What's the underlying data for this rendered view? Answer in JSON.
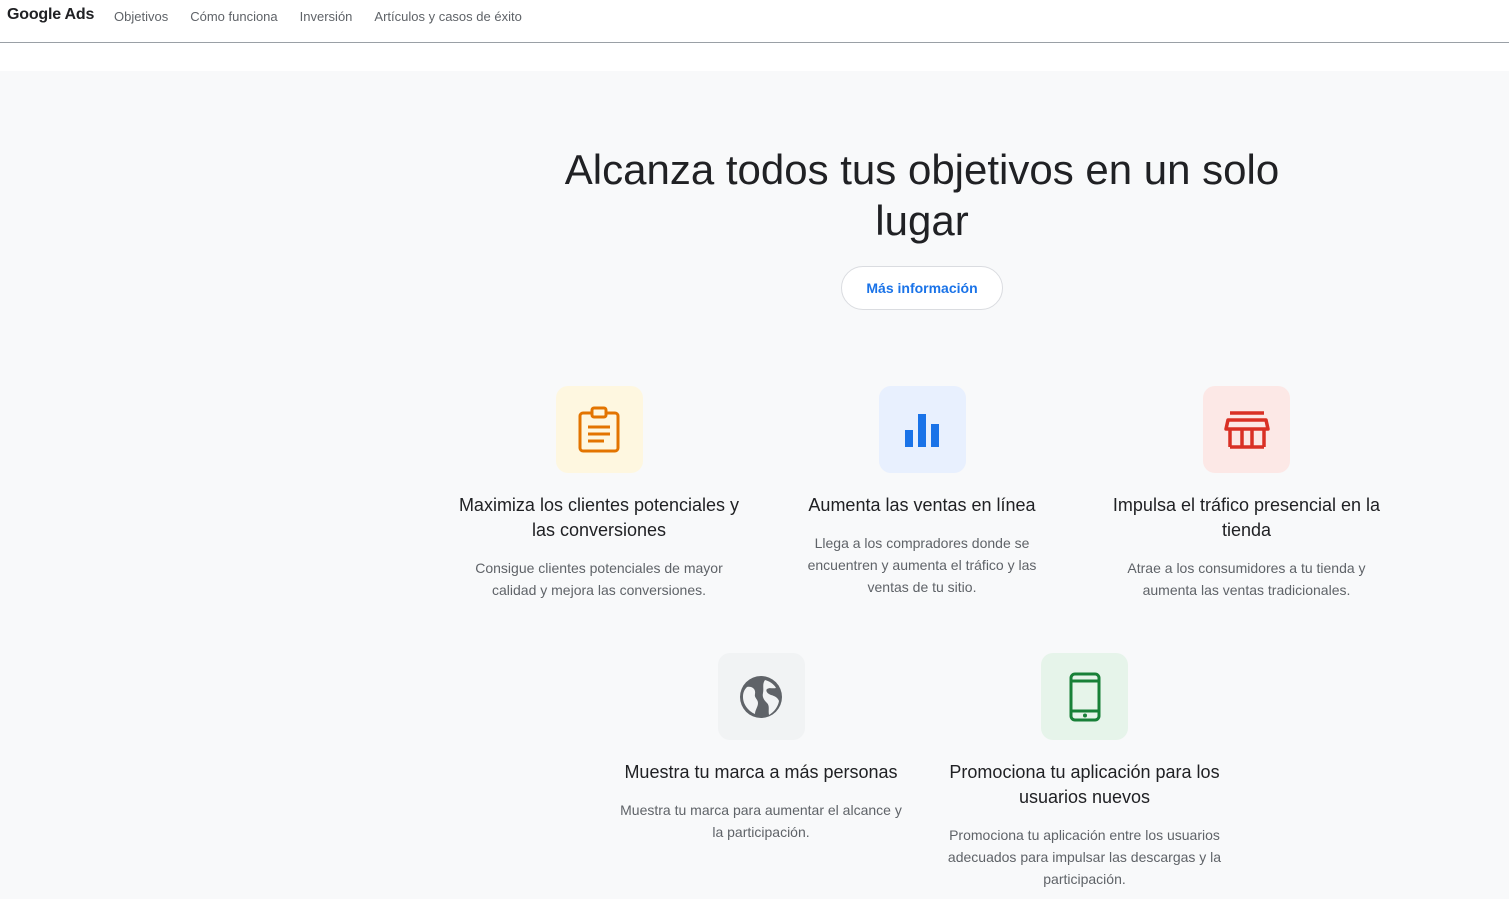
{
  "header": {
    "brand": "Google Ads",
    "nav": [
      {
        "label": "Objetivos"
      },
      {
        "label": "Cómo funciona"
      },
      {
        "label": "Inversión"
      },
      {
        "label": "Artículos y casos de éxito"
      }
    ]
  },
  "hero": {
    "title": "Alcanza todos tus objetivos en un solo lugar",
    "cta_label": "Más información"
  },
  "goals": [
    {
      "icon": "clipboard-icon",
      "title": "Maximiza los clientes potenciales y las conversiones",
      "description": "Consigue clientes potenciales de mayor calidad y mejora las conversiones."
    },
    {
      "icon": "bar-chart-icon",
      "title": "Aumenta las ventas en línea",
      "description": "Llega a los compradores donde se encuentren y aumenta el tráfico y las ventas de tu sitio."
    },
    {
      "icon": "storefront-icon",
      "title": "Impulsa el tráfico presencial en la tienda",
      "description": "Atrae a los consumidores a tu tienda y aumenta las ventas tradicionales."
    },
    {
      "icon": "globe-icon",
      "title": "Muestra tu marca a más personas",
      "description": "Muestra tu marca para aumentar el alcance y la participación."
    },
    {
      "icon": "mobile-phone-icon",
      "title": "Promociona tu aplicación para los usuarios nuevos",
      "description": "Promociona tu aplicación entre los usuarios adecuados para impulsar las descargas y la participación."
    }
  ],
  "colors": {
    "accent_blue": "#1a73e8",
    "icon_yellow": "#e37400",
    "icon_red": "#d93025",
    "icon_grey": "#5f6368",
    "icon_green": "#188038"
  }
}
